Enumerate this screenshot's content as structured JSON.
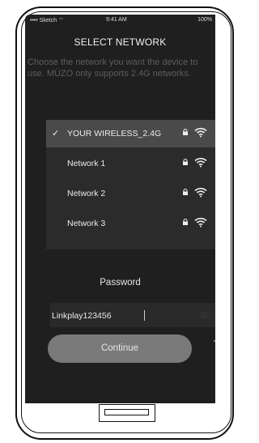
{
  "status_bar": {
    "carrier": "•••• Sketch ⌔",
    "time": "9:41 AM",
    "battery": "100%"
  },
  "header": {
    "title": "SELECT NETWORK"
  },
  "description": "Choose the network you want the device to use. MÜZO only supports 2.4G networks.",
  "networks": [
    {
      "name": "YOUR WIRELESS_2.4G",
      "selected": true
    },
    {
      "name": "Network 1",
      "selected": false
    },
    {
      "name": "Network 2",
      "selected": false
    },
    {
      "name": "Network 3",
      "selected": false
    }
  ],
  "password": {
    "label": "Password",
    "value": "Linkplay123456"
  },
  "continue_label": "Continue",
  "colors": {
    "screen_bg": "#1f1f1f",
    "selected_row": "#4a4a4a",
    "button": "#7a7a7a"
  },
  "icons": [
    "checkmark-icon",
    "lock-icon",
    "wifi-icon",
    "eye-icon"
  ]
}
